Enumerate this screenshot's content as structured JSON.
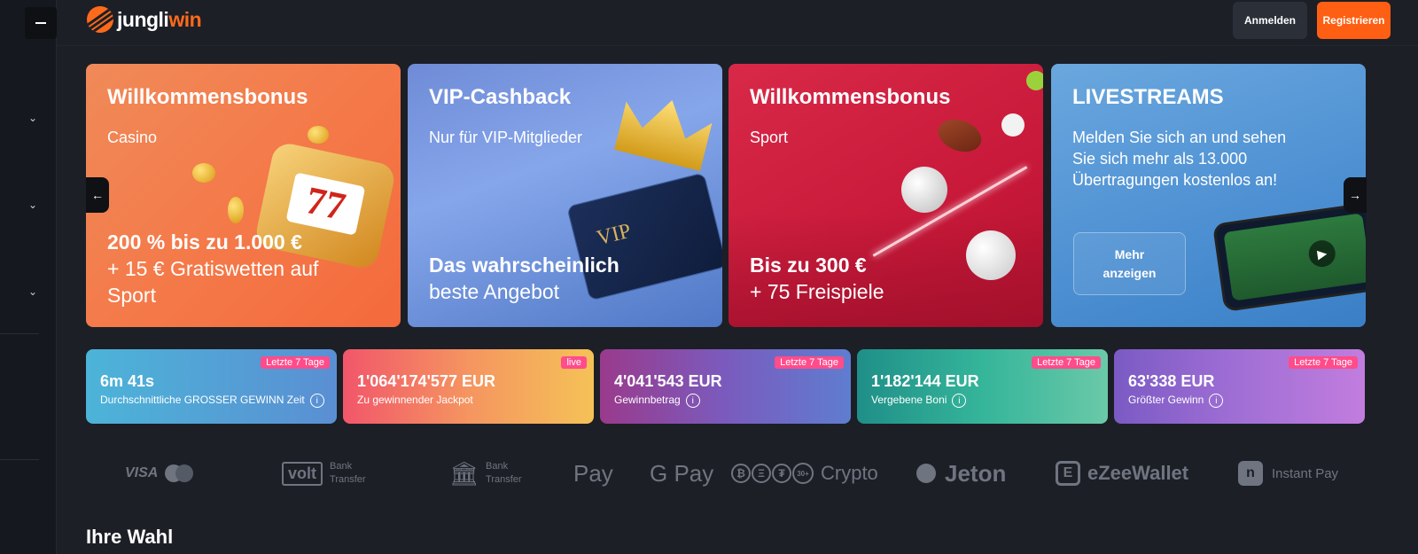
{
  "brand": {
    "name_part1": "jungli",
    "name_part2": "win",
    "accent": "#ff6a1a"
  },
  "header": {
    "login_label": "Anmelden",
    "register_label": "Registrieren"
  },
  "sidebar": {
    "chevrons": [
      "chevron-down",
      "chevron-down",
      "chevron-down"
    ]
  },
  "banners": [
    {
      "title": "Willkommensbonus",
      "subtitle": "Casino",
      "offer_line1": "200 % bis zu 1.000 €",
      "offer_line2": "+ 15 € Gratiswetten auf",
      "offer_line3": "Sport"
    },
    {
      "title": "VIP-Cashback",
      "subtitle": "Nur für VIP-Mitglieder",
      "offer_line1": "Das wahrscheinlich",
      "offer_line2": "beste Angebot"
    },
    {
      "title": "Willkommensbonus",
      "subtitle": "Sport",
      "offer_line1": "Bis zu 300 €",
      "offer_line2": "+ 75 Freispiele"
    },
    {
      "title": "LIVESTREAMS",
      "subtitle_line1": "Melden Sie sich an und sehen",
      "subtitle_line2": "Sie sich mehr als 13.000",
      "subtitle_line3": "Übertragungen kostenlos an!",
      "button_line1": "Mehr",
      "button_line2": "anzeigen"
    }
  ],
  "stats": [
    {
      "badge": "Letzte 7 Tage",
      "value": "6m 41s",
      "label": "Durchschnittliche GROSSER GEWINN Zeit"
    },
    {
      "badge": "live",
      "value": "1'064'174'577 EUR",
      "label": "Zu gewinnender Jackpot"
    },
    {
      "badge": "Letzte 7 Tage",
      "value": "4'041'543 EUR",
      "label": "Gewinnbetrag"
    },
    {
      "badge": "Letzte 7 Tage",
      "value": "1'182'144 EUR",
      "label": "Vergebene Boni"
    },
    {
      "badge": "Letzte 7 Tage",
      "value": "63'338 EUR",
      "label": "Größter Gewinn"
    }
  ],
  "payments": {
    "visa": "VISA",
    "volt": "volt",
    "volt_sub1": "Bank",
    "volt_sub2": "Transfer",
    "bank_sub1": "Bank",
    "bank_sub2": "Transfer",
    "apple_pay": "Pay",
    "google_pay": "G Pay",
    "crypto": "Crypto",
    "crypto_more": "30+",
    "jeton": "Jeton",
    "ezeewallet": "eZeeWallet",
    "instant_pay": "Instant Pay"
  },
  "section": {
    "title": "Ihre Wahl"
  }
}
